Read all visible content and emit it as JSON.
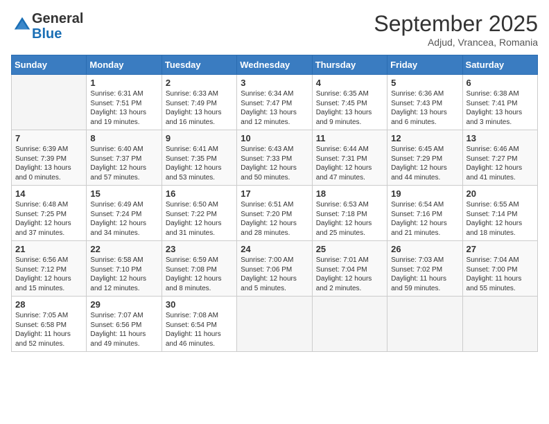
{
  "logo": {
    "general": "General",
    "blue": "Blue"
  },
  "header": {
    "month": "September 2025",
    "location": "Adjud, Vrancea, Romania"
  },
  "weekdays": [
    "Sunday",
    "Monday",
    "Tuesday",
    "Wednesday",
    "Thursday",
    "Friday",
    "Saturday"
  ],
  "weeks": [
    [
      {
        "day": "",
        "info": ""
      },
      {
        "day": "1",
        "info": "Sunrise: 6:31 AM\nSunset: 7:51 PM\nDaylight: 13 hours and 19 minutes."
      },
      {
        "day": "2",
        "info": "Sunrise: 6:33 AM\nSunset: 7:49 PM\nDaylight: 13 hours and 16 minutes."
      },
      {
        "day": "3",
        "info": "Sunrise: 6:34 AM\nSunset: 7:47 PM\nDaylight: 13 hours and 12 minutes."
      },
      {
        "day": "4",
        "info": "Sunrise: 6:35 AM\nSunset: 7:45 PM\nDaylight: 13 hours and 9 minutes."
      },
      {
        "day": "5",
        "info": "Sunrise: 6:36 AM\nSunset: 7:43 PM\nDaylight: 13 hours and 6 minutes."
      },
      {
        "day": "6",
        "info": "Sunrise: 6:38 AM\nSunset: 7:41 PM\nDaylight: 13 hours and 3 minutes."
      }
    ],
    [
      {
        "day": "7",
        "info": "Sunrise: 6:39 AM\nSunset: 7:39 PM\nDaylight: 13 hours and 0 minutes."
      },
      {
        "day": "8",
        "info": "Sunrise: 6:40 AM\nSunset: 7:37 PM\nDaylight: 12 hours and 57 minutes."
      },
      {
        "day": "9",
        "info": "Sunrise: 6:41 AM\nSunset: 7:35 PM\nDaylight: 12 hours and 53 minutes."
      },
      {
        "day": "10",
        "info": "Sunrise: 6:43 AM\nSunset: 7:33 PM\nDaylight: 12 hours and 50 minutes."
      },
      {
        "day": "11",
        "info": "Sunrise: 6:44 AM\nSunset: 7:31 PM\nDaylight: 12 hours and 47 minutes."
      },
      {
        "day": "12",
        "info": "Sunrise: 6:45 AM\nSunset: 7:29 PM\nDaylight: 12 hours and 44 minutes."
      },
      {
        "day": "13",
        "info": "Sunrise: 6:46 AM\nSunset: 7:27 PM\nDaylight: 12 hours and 41 minutes."
      }
    ],
    [
      {
        "day": "14",
        "info": "Sunrise: 6:48 AM\nSunset: 7:25 PM\nDaylight: 12 hours and 37 minutes."
      },
      {
        "day": "15",
        "info": "Sunrise: 6:49 AM\nSunset: 7:24 PM\nDaylight: 12 hours and 34 minutes."
      },
      {
        "day": "16",
        "info": "Sunrise: 6:50 AM\nSunset: 7:22 PM\nDaylight: 12 hours and 31 minutes."
      },
      {
        "day": "17",
        "info": "Sunrise: 6:51 AM\nSunset: 7:20 PM\nDaylight: 12 hours and 28 minutes."
      },
      {
        "day": "18",
        "info": "Sunrise: 6:53 AM\nSunset: 7:18 PM\nDaylight: 12 hours and 25 minutes."
      },
      {
        "day": "19",
        "info": "Sunrise: 6:54 AM\nSunset: 7:16 PM\nDaylight: 12 hours and 21 minutes."
      },
      {
        "day": "20",
        "info": "Sunrise: 6:55 AM\nSunset: 7:14 PM\nDaylight: 12 hours and 18 minutes."
      }
    ],
    [
      {
        "day": "21",
        "info": "Sunrise: 6:56 AM\nSunset: 7:12 PM\nDaylight: 12 hours and 15 minutes."
      },
      {
        "day": "22",
        "info": "Sunrise: 6:58 AM\nSunset: 7:10 PM\nDaylight: 12 hours and 12 minutes."
      },
      {
        "day": "23",
        "info": "Sunrise: 6:59 AM\nSunset: 7:08 PM\nDaylight: 12 hours and 8 minutes."
      },
      {
        "day": "24",
        "info": "Sunrise: 7:00 AM\nSunset: 7:06 PM\nDaylight: 12 hours and 5 minutes."
      },
      {
        "day": "25",
        "info": "Sunrise: 7:01 AM\nSunset: 7:04 PM\nDaylight: 12 hours and 2 minutes."
      },
      {
        "day": "26",
        "info": "Sunrise: 7:03 AM\nSunset: 7:02 PM\nDaylight: 11 hours and 59 minutes."
      },
      {
        "day": "27",
        "info": "Sunrise: 7:04 AM\nSunset: 7:00 PM\nDaylight: 11 hours and 55 minutes."
      }
    ],
    [
      {
        "day": "28",
        "info": "Sunrise: 7:05 AM\nSunset: 6:58 PM\nDaylight: 11 hours and 52 minutes."
      },
      {
        "day": "29",
        "info": "Sunrise: 7:07 AM\nSunset: 6:56 PM\nDaylight: 11 hours and 49 minutes."
      },
      {
        "day": "30",
        "info": "Sunrise: 7:08 AM\nSunset: 6:54 PM\nDaylight: 11 hours and 46 minutes."
      },
      {
        "day": "",
        "info": ""
      },
      {
        "day": "",
        "info": ""
      },
      {
        "day": "",
        "info": ""
      },
      {
        "day": "",
        "info": ""
      }
    ]
  ]
}
